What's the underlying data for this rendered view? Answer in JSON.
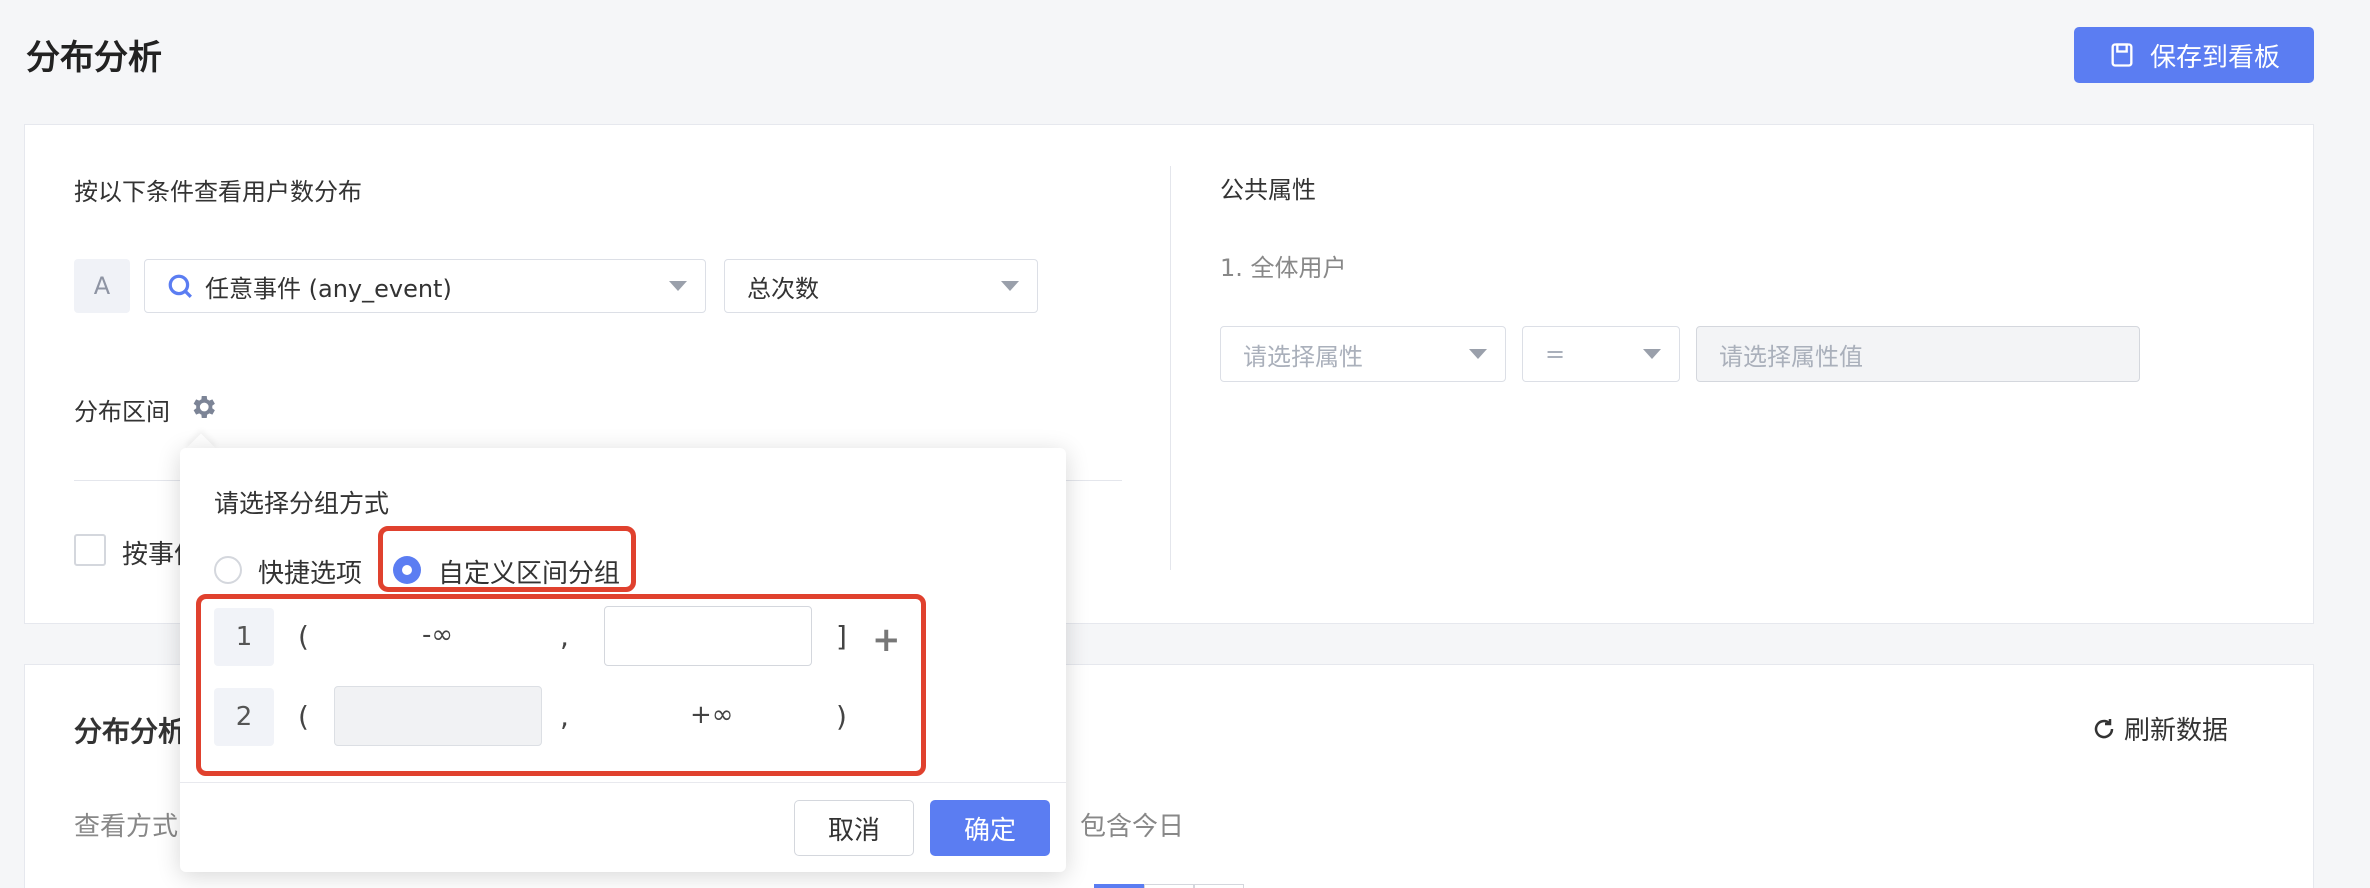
{
  "header": {
    "title": "分布分析",
    "save_button": "保存到看板",
    "save_icon": "save-icon"
  },
  "conditions": {
    "section_title": "按以下条件查看用户数分布",
    "row_label": "A",
    "event_select": "任意事件 (any_event)",
    "metric_select": "总次数",
    "distribution_label": "分布区间",
    "checkbox_label_partial": "按事件"
  },
  "public_attrs": {
    "title": "公共属性",
    "item": "1. 全体用户",
    "attr_placeholder": "请选择属性",
    "operator": "=",
    "value_placeholder": "请选择属性值"
  },
  "popover": {
    "title": "请选择分组方式",
    "options": [
      {
        "label": "快捷选项",
        "checked": false
      },
      {
        "label": "自定义区间分组",
        "checked": true
      }
    ],
    "rows": [
      {
        "index": "1",
        "open": "(",
        "from": "-∞",
        "comma": ",",
        "to": "",
        "close": "]"
      },
      {
        "index": "2",
        "open": "(",
        "from": "",
        "comma": ",",
        "to": "+∞",
        "close": ")"
      }
    ],
    "add_icon": "plus-icon",
    "cancel": "取消",
    "confirm": "确定"
  },
  "analysis": {
    "title_partial": "分布分析",
    "refresh": "刷新数据",
    "view_mode_partial": "查看方式",
    "include_today": "包含今日"
  },
  "colors": {
    "accent": "#5b7df2",
    "highlight": "#e0412e"
  }
}
